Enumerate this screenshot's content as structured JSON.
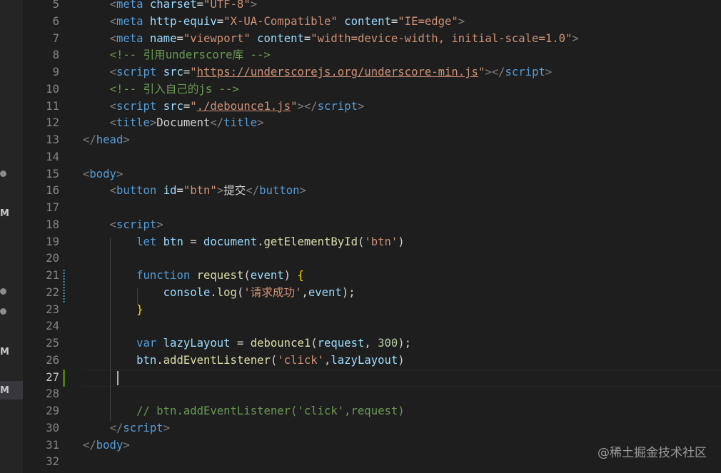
{
  "sidebar": {
    "markers": [
      "M",
      "M",
      "M"
    ]
  },
  "editor": {
    "active_line": "27",
    "lines": [
      {
        "n": "5",
        "parts": [
          [
            "ws",
            "    "
          ],
          [
            "br",
            "<"
          ],
          [
            "tag",
            "meta"
          ],
          [
            "ws",
            " "
          ],
          [
            "attr",
            "charset"
          ],
          [
            "txt",
            "="
          ],
          [
            "str",
            "\"UTF-8\""
          ],
          [
            "br",
            ">"
          ]
        ]
      },
      {
        "n": "6",
        "parts": [
          [
            "ws",
            "    "
          ],
          [
            "br",
            "<"
          ],
          [
            "tag",
            "meta"
          ],
          [
            "ws",
            " "
          ],
          [
            "attr",
            "http-equiv"
          ],
          [
            "txt",
            "="
          ],
          [
            "str",
            "\"X-UA-Compatible\""
          ],
          [
            "ws",
            " "
          ],
          [
            "attr",
            "content"
          ],
          [
            "txt",
            "="
          ],
          [
            "str",
            "\"IE=edge\""
          ],
          [
            "br",
            ">"
          ]
        ]
      },
      {
        "n": "7",
        "parts": [
          [
            "ws",
            "    "
          ],
          [
            "br",
            "<"
          ],
          [
            "tag",
            "meta"
          ],
          [
            "ws",
            " "
          ],
          [
            "attr",
            "name"
          ],
          [
            "txt",
            "="
          ],
          [
            "str",
            "\"viewport\""
          ],
          [
            "ws",
            " "
          ],
          [
            "attr",
            "content"
          ],
          [
            "txt",
            "="
          ],
          [
            "str",
            "\"width=device-width, initial-scale=1.0\""
          ],
          [
            "br",
            ">"
          ]
        ]
      },
      {
        "n": "8",
        "parts": [
          [
            "ws",
            "    "
          ],
          [
            "com",
            "<!-- 引用underscore库 -->"
          ]
        ]
      },
      {
        "n": "9",
        "parts": [
          [
            "ws",
            "    "
          ],
          [
            "br",
            "<"
          ],
          [
            "tag",
            "script"
          ],
          [
            "ws",
            " "
          ],
          [
            "attr",
            "src"
          ],
          [
            "txt",
            "="
          ],
          [
            "str",
            "\""
          ],
          [
            "stru",
            "https://underscorejs.org/underscore-min.js"
          ],
          [
            "str",
            "\""
          ],
          [
            "br",
            ">"
          ],
          [
            "br",
            "</"
          ],
          [
            "tag",
            "script"
          ],
          [
            "br",
            ">"
          ]
        ]
      },
      {
        "n": "10",
        "parts": [
          [
            "ws",
            "    "
          ],
          [
            "com",
            "<!-- 引入自己的js -->"
          ]
        ]
      },
      {
        "n": "11",
        "parts": [
          [
            "ws",
            "    "
          ],
          [
            "br",
            "<"
          ],
          [
            "tag",
            "script"
          ],
          [
            "ws",
            " "
          ],
          [
            "attr",
            "src"
          ],
          [
            "txt",
            "="
          ],
          [
            "str",
            "\""
          ],
          [
            "stru",
            "./debounce1.js"
          ],
          [
            "str",
            "\""
          ],
          [
            "br",
            ">"
          ],
          [
            "br",
            "</"
          ],
          [
            "tag",
            "script"
          ],
          [
            "br",
            ">"
          ]
        ]
      },
      {
        "n": "12",
        "parts": [
          [
            "ws",
            "    "
          ],
          [
            "br",
            "<"
          ],
          [
            "tag",
            "title"
          ],
          [
            "br",
            ">"
          ],
          [
            "txt",
            "Document"
          ],
          [
            "br",
            "</"
          ],
          [
            "tag",
            "title"
          ],
          [
            "br",
            ">"
          ]
        ]
      },
      {
        "n": "13",
        "parts": [
          [
            "br",
            "</"
          ],
          [
            "tag",
            "head"
          ],
          [
            "br",
            ">"
          ]
        ]
      },
      {
        "n": "14",
        "parts": []
      },
      {
        "n": "15",
        "parts": [
          [
            "br",
            "<"
          ],
          [
            "tag",
            "body"
          ],
          [
            "br",
            ">"
          ]
        ]
      },
      {
        "n": "16",
        "parts": [
          [
            "ws",
            "    "
          ],
          [
            "br",
            "<"
          ],
          [
            "tag",
            "button"
          ],
          [
            "ws",
            " "
          ],
          [
            "attr",
            "id"
          ],
          [
            "txt",
            "="
          ],
          [
            "str",
            "\"btn\""
          ],
          [
            "br",
            ">"
          ],
          [
            "txt",
            "提交"
          ],
          [
            "br",
            "</"
          ],
          [
            "tag",
            "button"
          ],
          [
            "br",
            ">"
          ]
        ]
      },
      {
        "n": "17",
        "parts": []
      },
      {
        "n": "18",
        "parts": [
          [
            "ws",
            "    "
          ],
          [
            "br",
            "<"
          ],
          [
            "tag",
            "script"
          ],
          [
            "br",
            ">"
          ]
        ]
      },
      {
        "n": "19",
        "parts": [
          [
            "ws",
            "        "
          ],
          [
            "kw",
            "let"
          ],
          [
            "ws",
            " "
          ],
          [
            "var",
            "btn"
          ],
          [
            "txt",
            " = "
          ],
          [
            "var",
            "document"
          ],
          [
            "txt",
            "."
          ],
          [
            "fn",
            "getElementById"
          ],
          [
            "txt",
            "("
          ],
          [
            "str",
            "'btn'"
          ],
          [
            "txt",
            ")"
          ]
        ]
      },
      {
        "n": "20",
        "parts": []
      },
      {
        "n": "21",
        "parts": [
          [
            "ws",
            "        "
          ],
          [
            "kw",
            "function"
          ],
          [
            "ws",
            " "
          ],
          [
            "fn",
            "request"
          ],
          [
            "txt",
            "("
          ],
          [
            "var",
            "event"
          ],
          [
            "txt",
            ") "
          ],
          [
            "brace",
            "{"
          ]
        ]
      },
      {
        "n": "22",
        "parts": [
          [
            "ws",
            "            "
          ],
          [
            "var",
            "console"
          ],
          [
            "txt",
            "."
          ],
          [
            "fn",
            "log"
          ],
          [
            "txt",
            "("
          ],
          [
            "str",
            "'请求成功'"
          ],
          [
            "txt",
            ","
          ],
          [
            "var",
            "event"
          ],
          [
            "txt",
            ");"
          ]
        ]
      },
      {
        "n": "23",
        "parts": [
          [
            "ws",
            "        "
          ],
          [
            "brace",
            "}"
          ]
        ]
      },
      {
        "n": "24",
        "parts": []
      },
      {
        "n": "25",
        "parts": [
          [
            "ws",
            "        "
          ],
          [
            "kw",
            "var"
          ],
          [
            "ws",
            " "
          ],
          [
            "var",
            "lazyLayout"
          ],
          [
            "txt",
            " = "
          ],
          [
            "fn",
            "debounce1"
          ],
          [
            "txt",
            "("
          ],
          [
            "var",
            "request"
          ],
          [
            "txt",
            ", "
          ],
          [
            "num",
            "300"
          ],
          [
            "txt",
            ");"
          ]
        ]
      },
      {
        "n": "26",
        "parts": [
          [
            "ws",
            "        "
          ],
          [
            "var",
            "btn"
          ],
          [
            "txt",
            "."
          ],
          [
            "fn",
            "addEventListener"
          ],
          [
            "txt",
            "("
          ],
          [
            "str",
            "'click'"
          ],
          [
            "txt",
            ","
          ],
          [
            "var",
            "lazyLayout"
          ],
          [
            "txt",
            ")"
          ]
        ]
      },
      {
        "n": "27",
        "parts": []
      },
      {
        "n": "28",
        "parts": []
      },
      {
        "n": "29",
        "parts": [
          [
            "ws",
            "        "
          ],
          [
            "com",
            "// btn.addEventListener('click',request)"
          ]
        ]
      },
      {
        "n": "30",
        "parts": [
          [
            "ws",
            "    "
          ],
          [
            "br",
            "</"
          ],
          [
            "tag",
            "script"
          ],
          [
            "br",
            ">"
          ]
        ]
      },
      {
        "n": "31",
        "parts": [
          [
            "br",
            "</"
          ],
          [
            "tag",
            "body"
          ],
          [
            "br",
            ">"
          ]
        ]
      },
      {
        "n": "32",
        "parts": []
      }
    ]
  },
  "watermark": "@稀土掘金技术社区",
  "colors": {
    "background": "#1e1e1e",
    "tag": "#569cd6",
    "attribute": "#9cdcfe",
    "string": "#ce9178",
    "comment": "#6a9955",
    "function": "#dcdcaa",
    "number": "#b5cea8",
    "brace": "#ffd700"
  }
}
